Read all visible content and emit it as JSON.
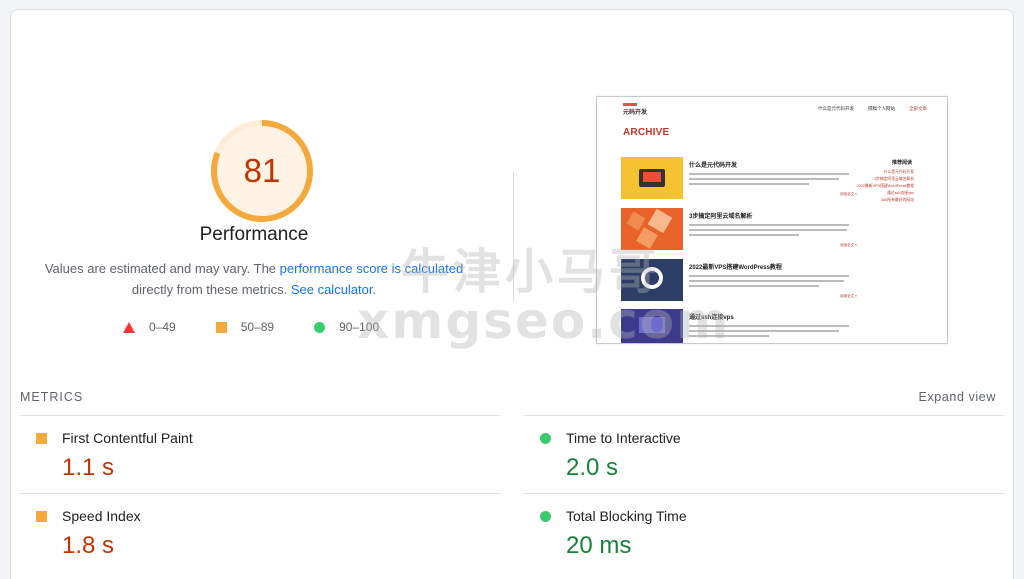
{
  "performance": {
    "score": "81",
    "score_fraction": 0.81,
    "title": "Performance",
    "desc_1": "Values are estimated and may vary. The ",
    "desc_link_1": "performance score is calculated",
    "desc_2": " directly from these metrics. ",
    "desc_link_2": "See calculator.",
    "colors": {
      "average": "#f4a93d",
      "average_text": "#c33300",
      "pass": "#3ccb6b",
      "fail": "#ff3333",
      "link": "#1a73e8"
    }
  },
  "legend": [
    {
      "icon": "triangle-red-icon",
      "range": "0–49"
    },
    {
      "icon": "square-orange-icon",
      "range": "50–89"
    },
    {
      "icon": "circle-green-icon",
      "range": "90–100"
    }
  ],
  "thumbnail": {
    "logo": "元码开发",
    "nav": [
      "什么是元代码开发",
      "撰稿个人网站",
      "全部文章"
    ],
    "heading": "ARCHIVE",
    "posts": [
      {
        "title": "什么是元代码开发",
        "more": "阅读全文 »"
      },
      {
        "title": "3步搞定阿里云域名解析",
        "more": "阅读全文 »"
      },
      {
        "title": "2022最新VPS搭建WordPress教程",
        "more": "阅读全文 »"
      },
      {
        "title": "通过ssh连接vps",
        "more": ""
      }
    ],
    "sidebar_title": "推荐阅读",
    "sidebar_items": [
      "什么是元代码开发",
      "3步搞定阿里云域名解析",
      "2022最新VPS搭建WordPress教程",
      "通过ssh连接vps",
      "360所有最好的网站"
    ]
  },
  "watermark": {
    "line1": "牛津小马哥",
    "line2": "xmgseo.com"
  },
  "metrics": {
    "label": "METRICS",
    "expand": "Expand view",
    "items": [
      {
        "name": "First Contentful Paint",
        "value": "1.1 s",
        "status": "average"
      },
      {
        "name": "Time to Interactive",
        "value": "2.0 s",
        "status": "pass"
      },
      {
        "name": "Speed Index",
        "value": "1.8 s",
        "status": "average"
      },
      {
        "name": "Total Blocking Time",
        "value": "20 ms",
        "status": "pass"
      }
    ]
  }
}
